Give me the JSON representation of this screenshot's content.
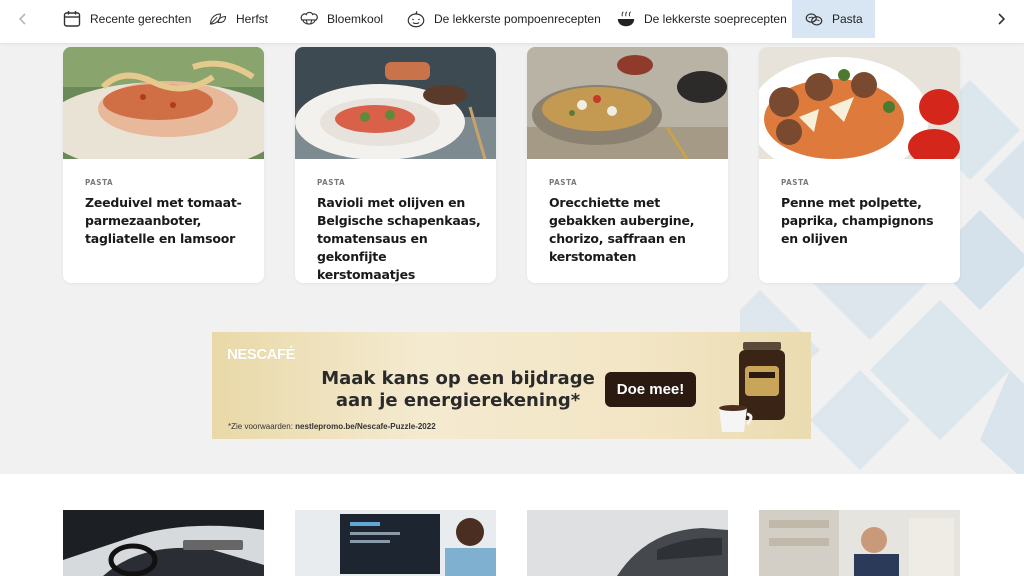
{
  "nav": {
    "items": [
      {
        "label": "Recente gerechten",
        "icon": "calendar-icon"
      },
      {
        "label": "Herfst",
        "icon": "leaf-icon"
      },
      {
        "label": "Bloemkool",
        "icon": "cauliflower-icon"
      },
      {
        "label": "De lekkerste pompoenrecepten",
        "icon": "pumpkin-icon"
      },
      {
        "label": "De lekkerste soeprecepten",
        "icon": "soup-bowl-icon"
      },
      {
        "label": "Pasta",
        "icon": "pasta-icon"
      }
    ],
    "active_index": 5
  },
  "cards": [
    {
      "category": "PASTA",
      "title": "Zeeduivel met tomaat-parmezaanboter, tagliatelle en lamsoor"
    },
    {
      "category": "PASTA",
      "title": "Ravioli met olijven en Belgische schapenkaas, tomatensaus en gekonfijte kerstomaatjes"
    },
    {
      "category": "PASTA",
      "title": "Orecchiette met gebakken aubergine, chorizo, saffraan en kerstomaten"
    },
    {
      "category": "PASTA",
      "title": "Penne met polpette, paprika, champignons en olijven"
    }
  ],
  "ad": {
    "brand": "NESCAFÉ",
    "headline": "Maak kans op een bijdrage aan je energierekening*",
    "cta": "Doe mee!",
    "terms_prefix": "*Zie voorwaarden:",
    "terms_link": "nestlepromo.be/Nescafe-Puzzle-2022"
  },
  "colors": {
    "accent_active": "#d7e6f2",
    "cta_bg": "#2a1a12",
    "pattern_blue": "#c9dcea"
  }
}
